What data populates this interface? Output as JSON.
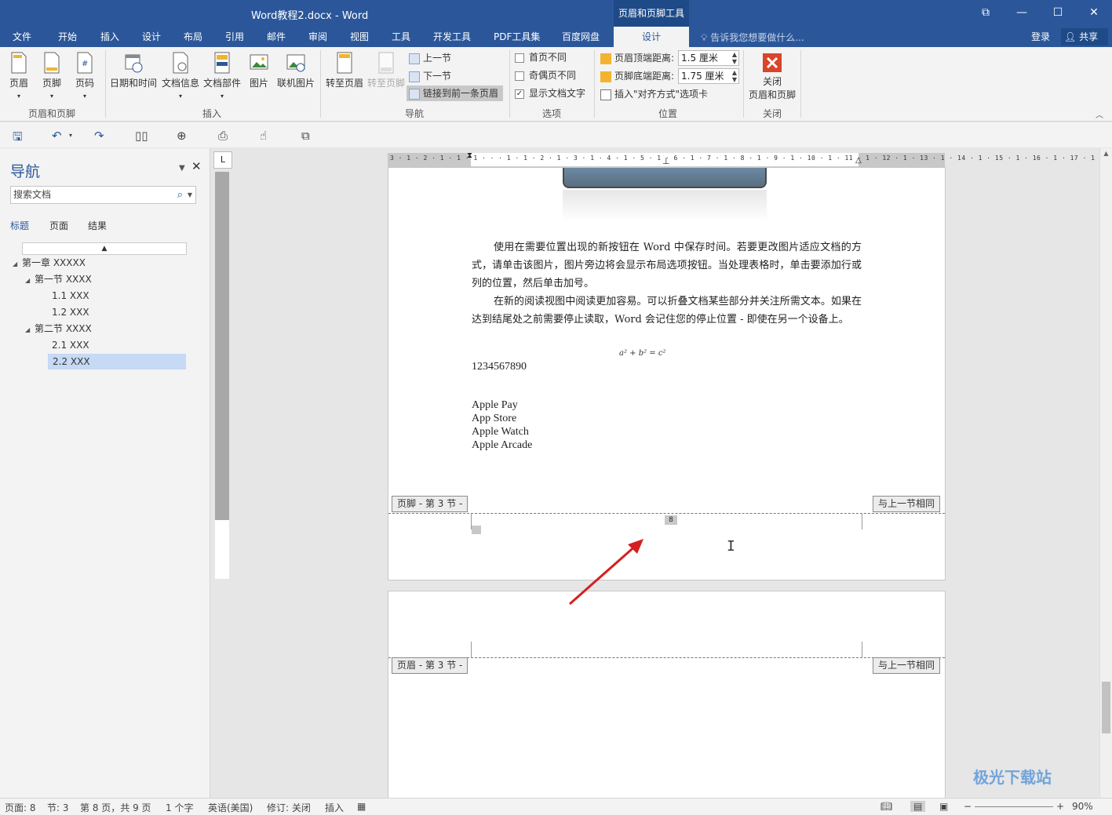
{
  "window": {
    "title": "Word教程2.docx - Word",
    "context_tab_group": "页眉和页脚工具"
  },
  "menu": {
    "tabs": [
      "文件",
      "开始",
      "插入",
      "设计",
      "布局",
      "引用",
      "邮件",
      "审阅",
      "视图",
      "工具",
      "开发工具",
      "PDF工具集",
      "百度网盘"
    ],
    "active_tab": "设计",
    "tell_me": "告诉我您想要做什么...",
    "login": "登录",
    "share": "共享"
  },
  "ribbon": {
    "header_footer_group": {
      "label": "页眉和页脚",
      "header": "页眉",
      "footer": "页脚",
      "page_number": "页码"
    },
    "insert_group": {
      "label": "插入",
      "datetime": "日期和时间",
      "docinfo": "文档信息",
      "docparts": "文档部件",
      "picture": "图片",
      "online_picture": "联机图片"
    },
    "nav_group": {
      "label": "导航",
      "goto_header": "转至页眉",
      "goto_footer": "转至页脚",
      "prev_section": "上一节",
      "next_section": "下一节",
      "link_previous": "链接到前一条页眉"
    },
    "options_group": {
      "label": "选项",
      "diff_first": "首页不同",
      "diff_odd_even": "奇偶页不同",
      "show_doc_text": "显示文档文字"
    },
    "position_group": {
      "label": "位置",
      "header_top_label": "页眉顶端距离:",
      "header_top_value": "1.5 厘米",
      "footer_bottom_label": "页脚底端距离:",
      "footer_bottom_value": "1.75 厘米",
      "insert_align_tab": "插入\"对齐方式\"选项卡"
    },
    "close_group": {
      "label": "关闭",
      "close_line1": "关闭",
      "close_line2": "页眉和页脚"
    }
  },
  "nav_pane": {
    "title": "导航",
    "search_placeholder": "搜索文档",
    "tabs": [
      "标题",
      "页面",
      "结果"
    ],
    "tree": [
      {
        "label": "第一章 XXXXX"
      },
      {
        "label": "第一节 XXXX"
      },
      {
        "label": "1.1 XXX"
      },
      {
        "label": "1.2 XXX"
      },
      {
        "label": "第二节 XXXX"
      },
      {
        "label": "2.1 XXX"
      },
      {
        "label": "2.2 XXX"
      }
    ]
  },
  "document": {
    "para1": "使用在需要位置出现的新按钮在 Word 中保存时间。若要更改图片适应文档的方式，请单击该图片，图片旁边将会显示布局选项按钮。当处理表格时，单击要添加行或列的位置，然后单击加号。",
    "para2": "在新的阅读视图中阅读更加容易。可以折叠文档某些部分并关注所需文本。如果在达到结尾处之前需要停止读取，Word 会记住您的停止位置 - 即使在另一个设备上。",
    "formula": "a² + b² = c²",
    "numbers": "1234567890",
    "list": [
      "Apple Pay",
      "App Store",
      "Apple Watch",
      "Apple Arcade"
    ],
    "footer_tag": "页脚 - 第 3 节 -",
    "header_tag": "页眉 - 第 3 节 -",
    "same_as_prev": "与上一节相同",
    "page_number": "8"
  },
  "ruler": {
    "h_ticks": "3 · 1 · 2 · 1 · 1 · 1 · · · 1 · 1 · 2 · 1 · 3 · 1 · 4 · 1 · 5 · 1 · 6 · 1 · 7 · 1 · 8 · 1 · 9 · 1 · 10 · 1 · 11 · 1 · 12 · 1 · 13 · 1 · 14 · 1 · 15 · 1 · 16 · 1 · 17 · 1",
    "corner": "L"
  },
  "status": {
    "page": "页面: 8",
    "section": "节: 3",
    "page_of": "第 8 页，共 9 页",
    "words": "1 个字",
    "language": "英语(美国)",
    "track": "修订: 关闭",
    "insert": "插入",
    "zoom": "90%"
  },
  "watermark": {
    "text": "极光下载站"
  },
  "colors": {
    "accent": "#2b579a",
    "arrow": "#d42020",
    "close_icon": "#d9442a"
  }
}
